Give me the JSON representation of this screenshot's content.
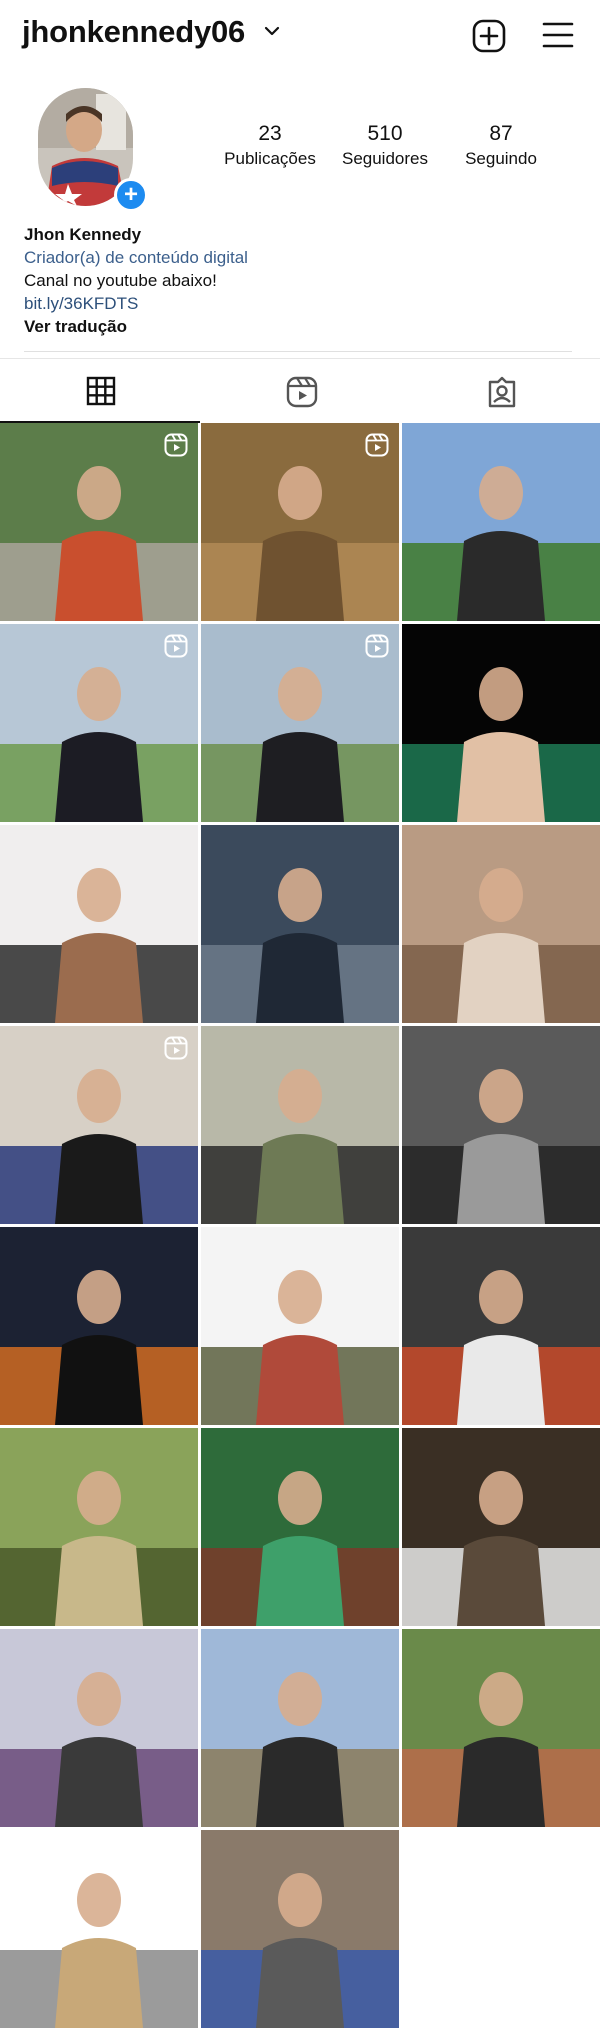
{
  "header": {
    "username": "jhonkennedy06",
    "icons": [
      "chevron-down-icon",
      "plus-square-icon",
      "hamburger-menu-icon"
    ]
  },
  "profile": {
    "stats": [
      {
        "value": "23",
        "label": "Publicações"
      },
      {
        "value": "510",
        "label": "Seguidores"
      },
      {
        "value": "87",
        "label": "Seguindo"
      }
    ],
    "name": "Jhon Kennedy",
    "category": "Criador(a) de conteúdo digital",
    "bio_line": "Canal no youtube abaixo!",
    "link": "bit.ly/36KFDTS",
    "translate": "Ver tradução"
  },
  "tabs": [
    {
      "icon": "grid-icon",
      "active": true
    },
    {
      "icon": "reels-icon",
      "active": false
    },
    {
      "icon": "tagged-icon",
      "active": false
    }
  ],
  "posts": [
    {
      "reel": true,
      "colors": [
        "#5c7d4a",
        "#a9a39a",
        "#c94f2e"
      ]
    },
    {
      "reel": true,
      "colors": [
        "#8a6b3e",
        "#b08a56",
        "#6f5230"
      ]
    },
    {
      "reel": false,
      "colors": [
        "#7fa6d6",
        "#3f7a2c",
        "#2a2a2a"
      ]
    },
    {
      "reel": true,
      "colors": [
        "#b7c7d6",
        "#6e9a4d",
        "#1c1c24"
      ]
    },
    {
      "reel": true,
      "colors": [
        "#a9bccd",
        "#6d8f4d",
        "#1e1e22"
      ]
    },
    {
      "reel": false,
      "colors": [
        "#050505",
        "#1e7a55",
        "#e1c0a5"
      ]
    },
    {
      "reel": false,
      "colors": [
        "#f0eeee",
        "#2b2b2b",
        "#9b6c4e"
      ]
    },
    {
      "reel": false,
      "colors": [
        "#3b4a5c",
        "#6d7a8a",
        "#1f2835"
      ]
    },
    {
      "reel": false,
      "colors": [
        "#b99b83",
        "#7a5e48",
        "#e2d2c2"
      ]
    },
    {
      "reel": true,
      "colors": [
        "#d7d0c6",
        "#2a3a7a",
        "#1a1a1a"
      ]
    },
    {
      "reel": false,
      "colors": [
        "#b8b8a8",
        "#2a2a2a",
        "#6e7a55"
      ]
    },
    {
      "reel": false,
      "colors": [
        "#5a5a5a",
        "#242424",
        "#9a9a9a"
      ]
    },
    {
      "reel": false,
      "colors": [
        "#1c2233",
        "#d06b22",
        "#111111"
      ]
    },
    {
      "reel": false,
      "colors": [
        "#f4f4f4",
        "#5a5f3e",
        "#b04a3a"
      ]
    },
    {
      "reel": false,
      "colors": [
        "#3a3a3a",
        "#c94b2a",
        "#e9e9e9"
      ]
    },
    {
      "reel": false,
      "colors": [
        "#8aa35a",
        "#4a5a2a",
        "#c8b88a"
      ]
    },
    {
      "reel": false,
      "colors": [
        "#2e6b3a",
        "#7a3a2a",
        "#3ea06a"
      ]
    },
    {
      "reel": false,
      "colors": [
        "#3a2f24",
        "#e8e8e8",
        "#5a4a3a"
      ]
    },
    {
      "reel": false,
      "colors": [
        "#c8c8d8",
        "#6a4a7a",
        "#3a3a3a"
      ]
    },
    {
      "reel": false,
      "colors": [
        "#9fb8d8",
        "#8a7a5a",
        "#2a2a2a"
      ]
    },
    {
      "reel": false,
      "colors": [
        "#6a8a4a",
        "#b86a4a",
        "#2a2a2a"
      ]
    },
    {
      "reel": false,
      "colors": [
        "#ffffff",
        "#8a8a8a",
        "#c8a878"
      ]
    },
    {
      "reel": false,
      "colors": [
        "#8a7a6a",
        "#3a5aa8",
        "#5a5a5a"
      ]
    }
  ]
}
